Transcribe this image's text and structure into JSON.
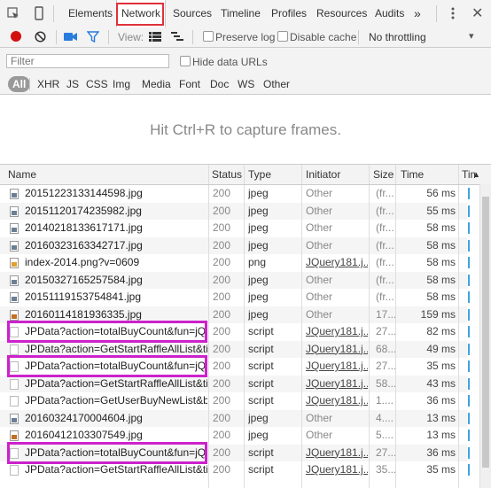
{
  "tabs": [
    "Elements",
    "Network",
    "Sources",
    "Timeline",
    "Profiles",
    "Resources",
    "Audits"
  ],
  "active_tab": "Network",
  "toolbar": {
    "view_label": "View:",
    "preserve_log": "Preserve log",
    "disable_cache": "Disable cache",
    "throttling": "No throttling"
  },
  "filter": {
    "placeholder": "Filter",
    "hide_data_urls": "Hide data URLs",
    "types": [
      "All",
      "XHR",
      "JS",
      "CSS",
      "Img",
      "Media",
      "Font",
      "Doc",
      "WS",
      "Other"
    ]
  },
  "overview_hint": "Hit Ctrl+R to capture frames.",
  "columns": [
    "Name",
    "Status",
    "Type",
    "Initiator",
    "Size",
    "Time",
    "Tim"
  ],
  "rows": [
    {
      "name": "20151223133144598.jpg",
      "status": "200",
      "type": "jpeg",
      "initiator": "Other",
      "size": "(fr...",
      "time": "56 ms",
      "icon": "img"
    },
    {
      "name": "20151120174235982.jpg",
      "status": "200",
      "type": "jpeg",
      "initiator": "Other",
      "size": "(fr...",
      "time": "55 ms",
      "icon": "img"
    },
    {
      "name": "20140218133617171.jpg",
      "status": "200",
      "type": "jpeg",
      "initiator": "Other",
      "size": "(fr...",
      "time": "58 ms",
      "icon": "img"
    },
    {
      "name": "20160323163342717.jpg",
      "status": "200",
      "type": "jpeg",
      "initiator": "Other",
      "size": "(fr...",
      "time": "58 ms",
      "icon": "img"
    },
    {
      "name": "index-2014.png?v=0609",
      "status": "200",
      "type": "png",
      "initiator": "JQuery181.j...",
      "size": "(fr...",
      "time": "58 ms",
      "icon": "png"
    },
    {
      "name": "20150327165257584.jpg",
      "status": "200",
      "type": "jpeg",
      "initiator": "Other",
      "size": "(fr...",
      "time": "58 ms",
      "icon": "img"
    },
    {
      "name": "20151119153754841.jpg",
      "status": "200",
      "type": "jpeg",
      "initiator": "Other",
      "size": "(fr...",
      "time": "58 ms",
      "icon": "img"
    },
    {
      "name": "20160114181936335.jpg",
      "status": "200",
      "type": "jpeg",
      "initiator": "Other",
      "size": "17...",
      "time": "159 ms",
      "icon": "orange"
    },
    {
      "name": "JPData?action=totalBuyCount&fun=jQ...",
      "status": "200",
      "type": "script",
      "initiator": "JQuery181.j...",
      "size": "27...",
      "time": "82 ms",
      "icon": "blank"
    },
    {
      "name": "JPData?action=GetStartRaffleAllList&ti...",
      "status": "200",
      "type": "script",
      "initiator": "JQuery181.j...",
      "size": "68...",
      "time": "49 ms",
      "icon": "blank"
    },
    {
      "name": "JPData?action=totalBuyCount&fun=jQ...",
      "status": "200",
      "type": "script",
      "initiator": "JQuery181.j...",
      "size": "27...",
      "time": "35 ms",
      "icon": "blank"
    },
    {
      "name": "JPData?action=GetStartRaffleAllList&ti...",
      "status": "200",
      "type": "script",
      "initiator": "JQuery181.j...",
      "size": "58...",
      "time": "43 ms",
      "icon": "blank"
    },
    {
      "name": "JPData?action=GetUserBuyNewList&bu...",
      "status": "200",
      "type": "script",
      "initiator": "JQuery181.j...",
      "size": "1....",
      "time": "36 ms",
      "icon": "blank"
    },
    {
      "name": "20160324170004604.jpg",
      "status": "200",
      "type": "jpeg",
      "initiator": "Other",
      "size": "4....",
      "time": "13 ms",
      "icon": "img"
    },
    {
      "name": "20160412103307549.jpg",
      "status": "200",
      "type": "jpeg",
      "initiator": "Other",
      "size": "5....",
      "time": "13 ms",
      "icon": "orange"
    },
    {
      "name": "JPData?action=totalBuyCount&fun=jQ...",
      "status": "200",
      "type": "script",
      "initiator": "JQuery181.j...",
      "size": "27...",
      "time": "36 ms",
      "icon": "blank"
    },
    {
      "name": "JPData?action=GetStartRaffleAllList&ti...",
      "status": "200",
      "type": "script",
      "initiator": "JQuery181.j...",
      "size": "35...",
      "time": "35 ms",
      "icon": "blank"
    }
  ],
  "highlighted_rows": [
    8,
    10,
    15
  ]
}
